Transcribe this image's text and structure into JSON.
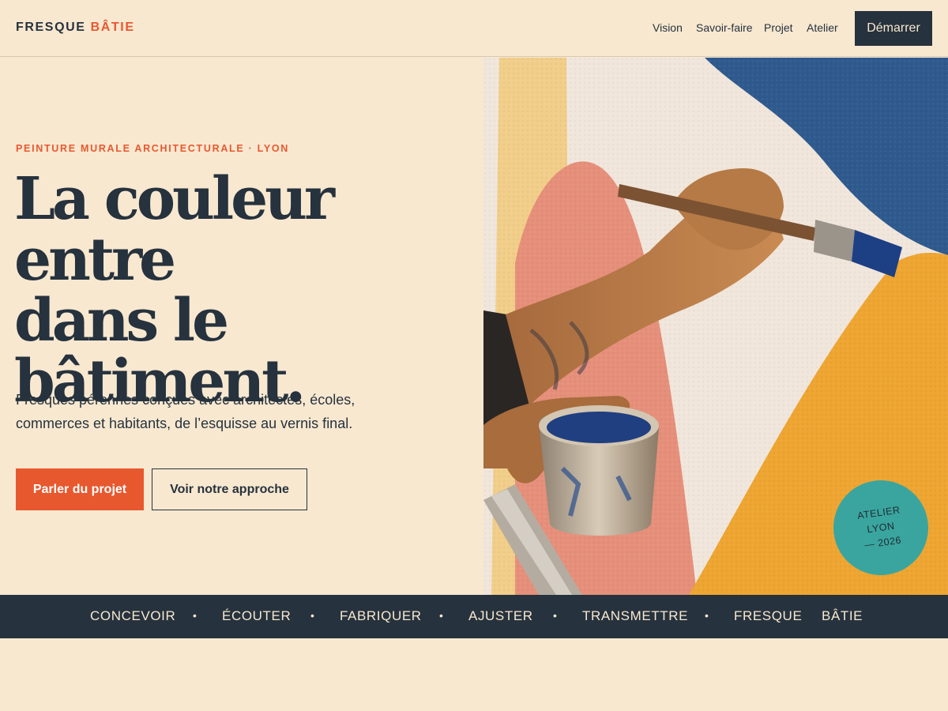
{
  "brand": {
    "name_part1": "FRESQUE",
    "name_part2": "BÂTIE"
  },
  "nav": {
    "items": [
      "Vision",
      "Savoir-faire",
      "Projet",
      "Atelier"
    ],
    "cta": "Démarrer"
  },
  "hero": {
    "eyebrow": "PEINTURE MURALE ARCHITECTURALE · LYON",
    "headline_lines": [
      "La couleur entre",
      "dans le",
      "bâtiment."
    ],
    "subtitle_lines": [
      "Fresques pérennes conçues avec architectes, écoles,",
      "commerces et habitants, de l’esquisse au vernis final."
    ],
    "primary_button": "Parler du projet",
    "secondary_button": "Voir notre approche"
  },
  "badge": {
    "lines": [
      "ATELIER",
      "LYON",
      "— 2026"
    ]
  },
  "ticker": {
    "items": [
      "CONCEVOIR",
      "ÉCOUTER",
      "FABRIQUER",
      "AJUSTER",
      "TRANSMETTRE",
      "FRESQUE",
      "BÂTIE"
    ],
    "separator": "•"
  },
  "colors": {
    "background": "#f8e8d0",
    "ink": "#26323d",
    "accent": "#e8582f",
    "badge": "#3aa59f",
    "ochre": "#eea531",
    "blue": "#2f5a8e",
    "pink": "#e68f7a"
  }
}
